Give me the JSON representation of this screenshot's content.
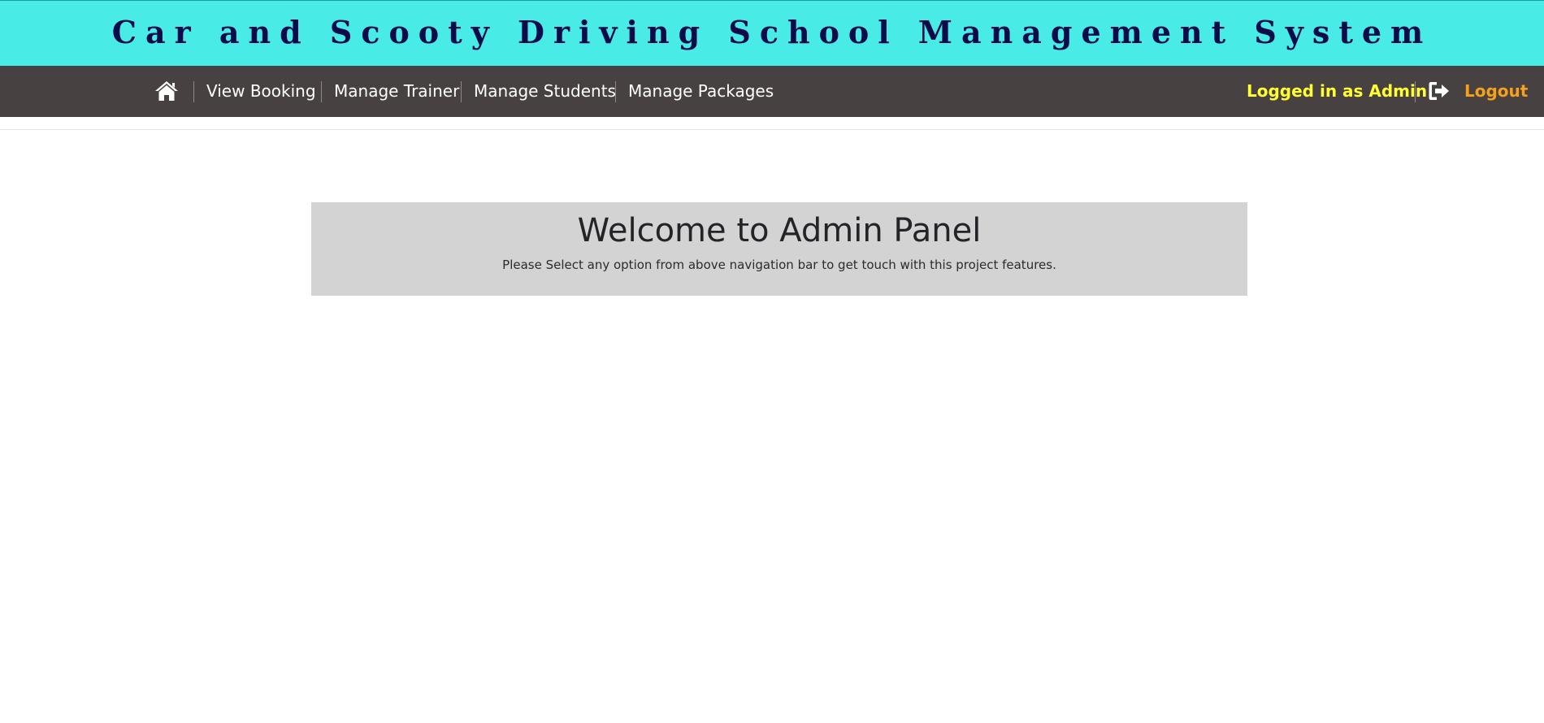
{
  "header": {
    "title": "Car and Scooty Driving School Management System"
  },
  "navbar": {
    "home_icon": "home-icon",
    "items": [
      {
        "label": "View Booking"
      },
      {
        "label": "Manage Trainer"
      },
      {
        "label": "Manage Students"
      },
      {
        "label": "Manage Packages"
      }
    ],
    "status": "Logged in as Admin",
    "logout_icon": "sign-out-icon",
    "logout_label": "Logout"
  },
  "main": {
    "welcome_title": "Welcome to Admin Panel",
    "welcome_subtitle": "Please Select any option from above navigation bar to get touch with this project features."
  },
  "colors": {
    "banner_bg": "#48ebe5",
    "banner_text": "#0d0b4a",
    "navbar_bg": "#474141",
    "status_text": "#ffff33",
    "logout_text": "#f5a11c",
    "welcome_bg": "#d3d3d3"
  }
}
